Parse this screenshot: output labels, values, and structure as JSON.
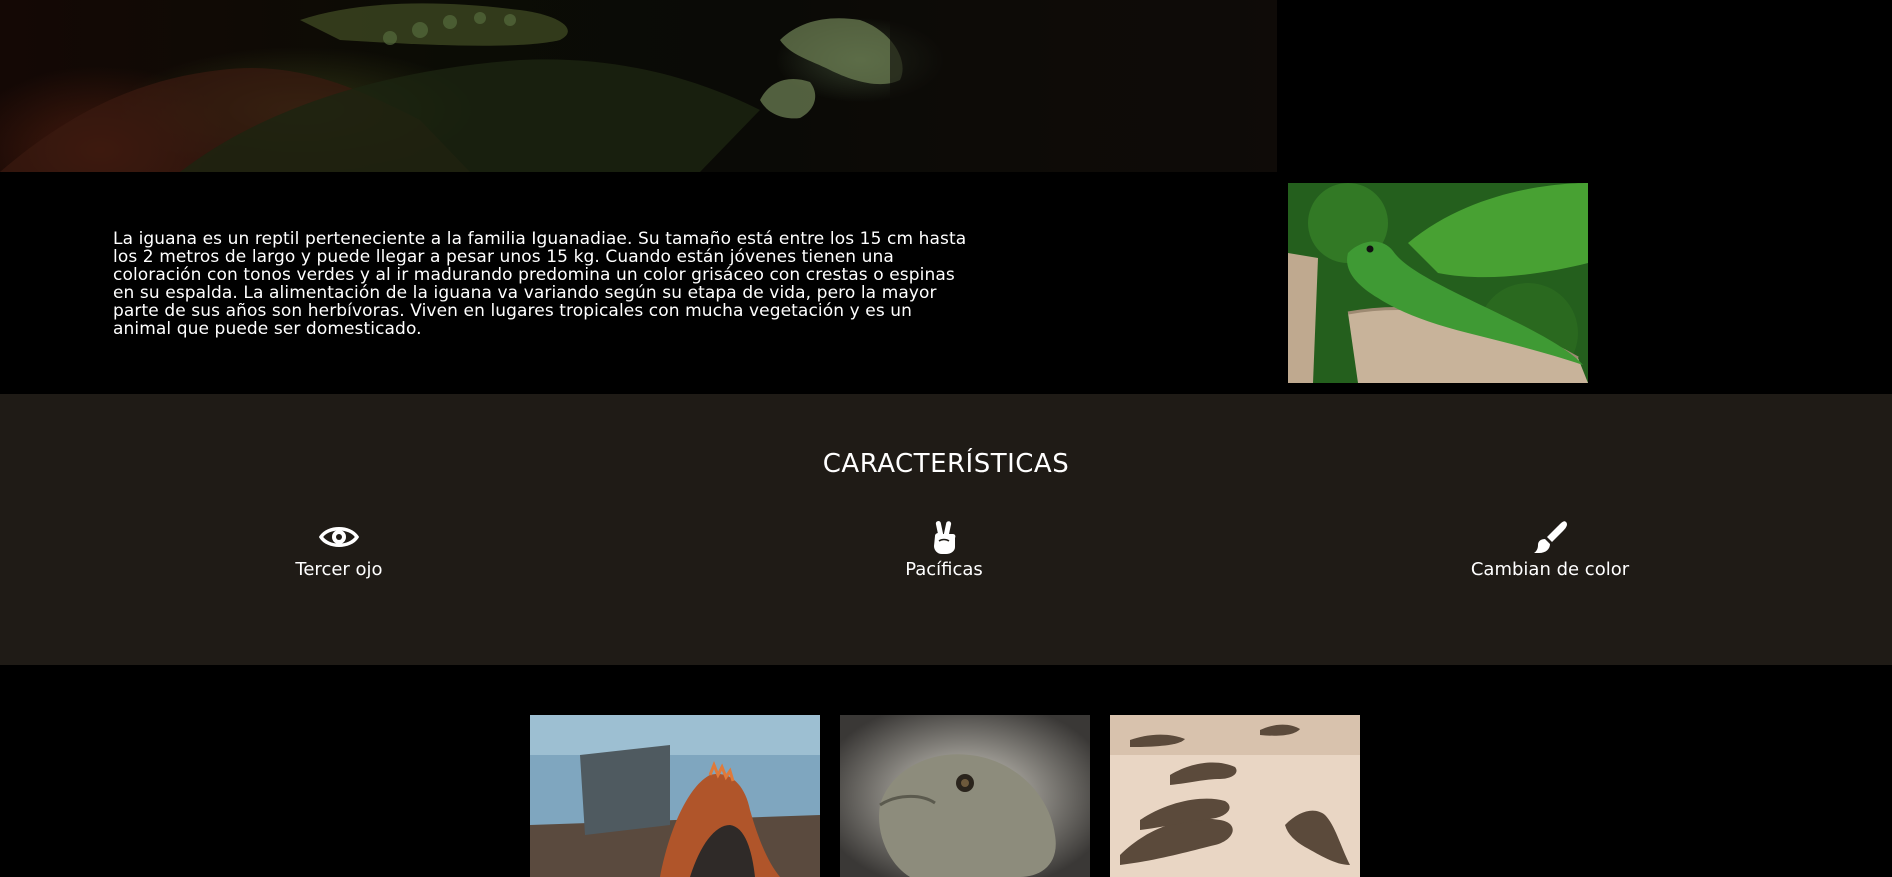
{
  "hero": {
    "image": "iguana-closeup-dark"
  },
  "intro": {
    "paragraph": "La iguana es un reptil perteneciente a la familia Iguanadiae. Su tamaño está entre los 15 cm hasta los 2 metros de largo y puede llegar a pesar unos 15 kg. Cuando están jóvenes tienen una coloración con tonos verdes y al ir madurando predomina un color grisáceo con crestas o espinas en su espalda. La alimentación de la iguana va variando según su etapa de vida, pero la mayor parte de sus años son herbívoras. Viven en lugares tropicales con mucha vegetación y es un animal que puede ser domesticado.",
    "image": "green-lizard-on-stump"
  },
  "features": {
    "title": "CARACTERÍSTICAS",
    "items": [
      {
        "icon": "eye-icon",
        "label": "Tercer ojo"
      },
      {
        "icon": "peace-hand-icon",
        "label": "Pacíficas"
      },
      {
        "icon": "paint-brush-icon",
        "label": "Cambian de color"
      }
    ]
  },
  "gallery": {
    "images": [
      "iguana-on-rocks-by-sea",
      "iguana-head-portrait",
      "iguanas-on-sand"
    ]
  },
  "colors": {
    "page_background": "#000000",
    "features_background": "#1f1b16",
    "text": "#ffffff"
  }
}
